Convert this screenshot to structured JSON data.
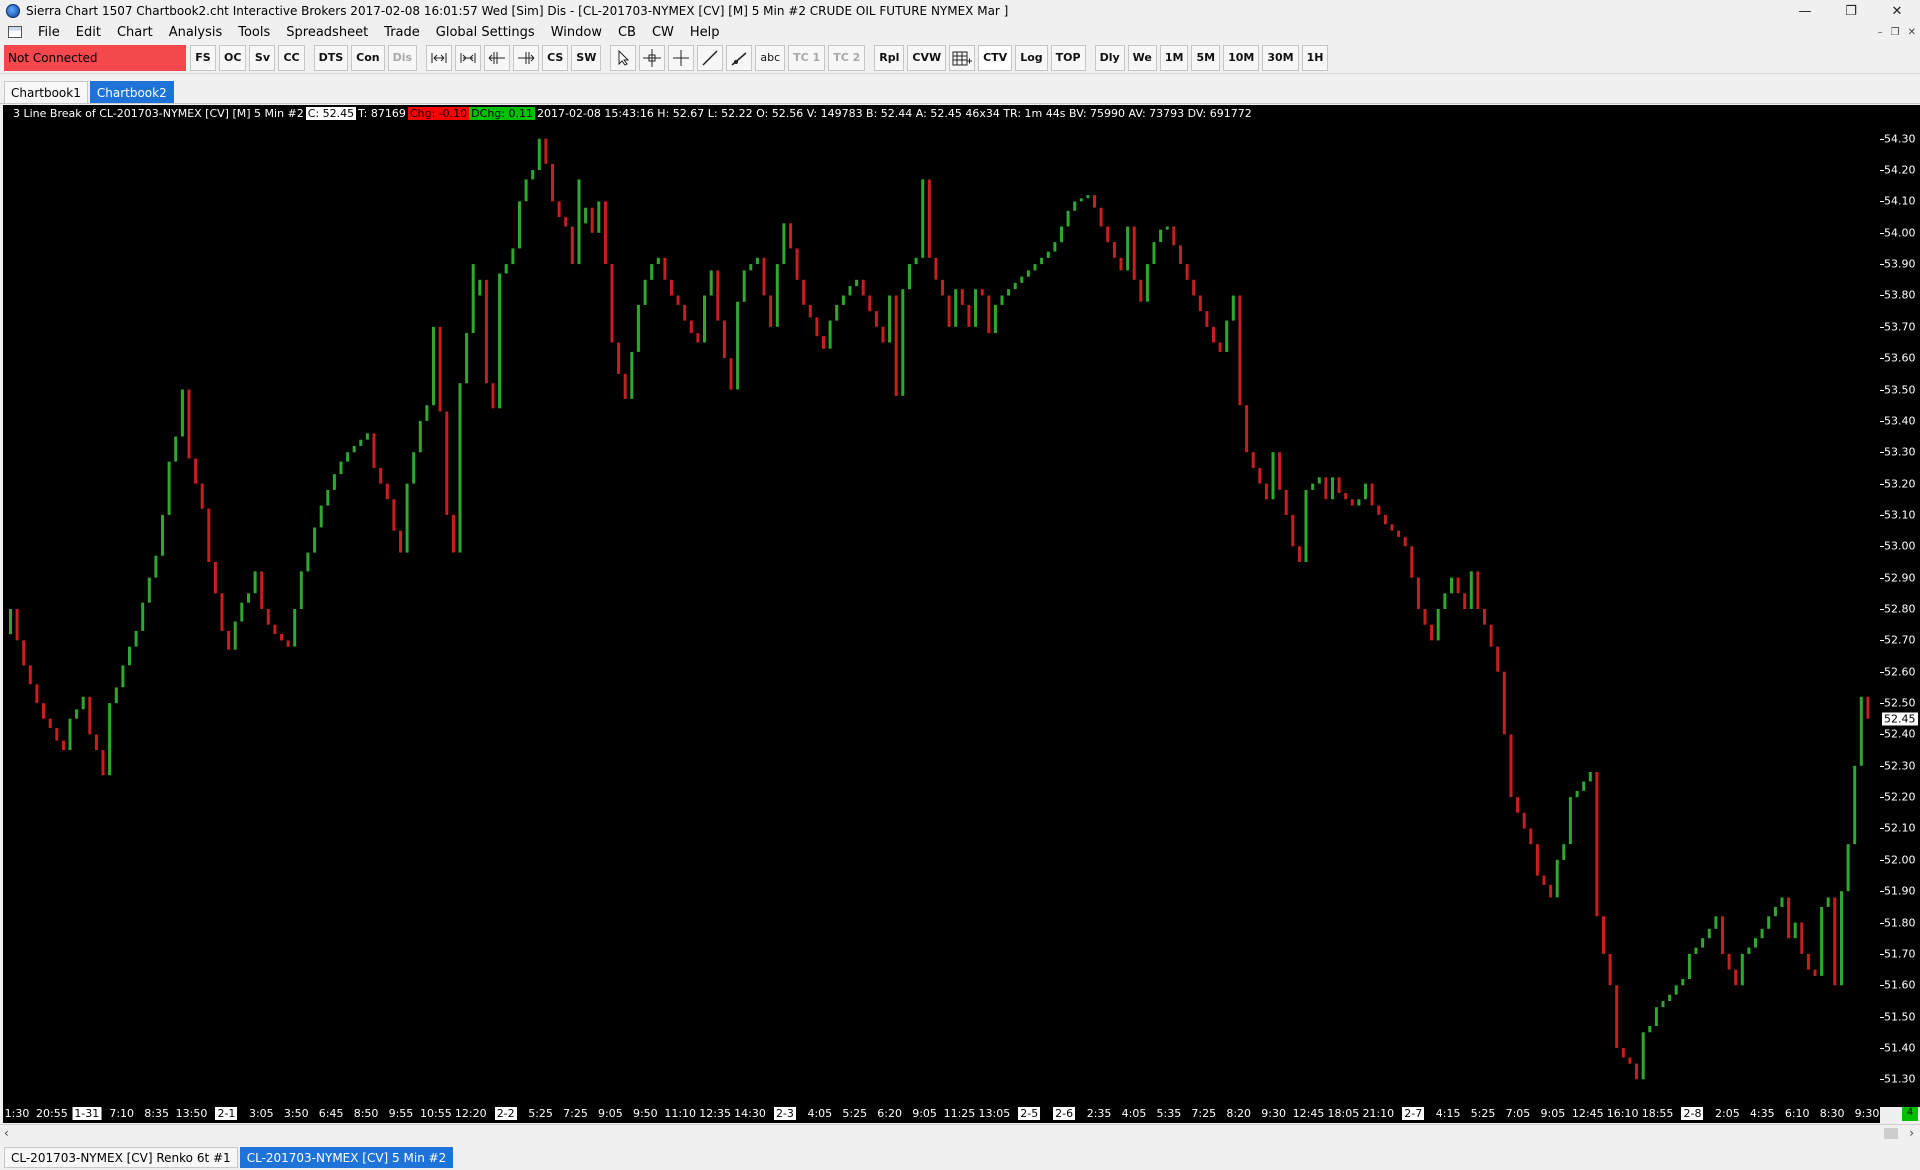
{
  "window": {
    "title": "Sierra Chart 1507 Chartbook2.cht  Interactive Brokers 2017-02-08  16:01:57 Wed [Sim]  Dis - [CL-201703-NYMEX [CV] [M]  5 Min  #2  CRUDE OIL FUTURE NYMEX Mar ]",
    "minimize": "—",
    "restore": "❐",
    "close": "✕"
  },
  "menu": {
    "items": [
      "File",
      "Edit",
      "Chart",
      "Analysis",
      "Tools",
      "Spreadsheet",
      "Trade",
      "Global Settings",
      "Window",
      "CB",
      "CW",
      "Help"
    ],
    "mdi": [
      "–",
      "❐",
      "✕"
    ]
  },
  "toolbar": {
    "status": "Not Connected",
    "group1": [
      "FS",
      "OC",
      "Sv",
      "CC"
    ],
    "group2": [
      "DTS",
      "Con",
      "Dis"
    ],
    "group3_icons": [
      "zoom-out-icon",
      "zoom-in-icon",
      "shift-left-icon",
      "shift-right-icon"
    ],
    "group3_labels": [
      "CS",
      "SW"
    ],
    "group4_icons": [
      "pointer-icon",
      "crosshair-icon",
      "cursor-cross-icon",
      "line-tool-icon",
      "ray-tool-icon"
    ],
    "group4_labels": [
      "abc",
      "TC 1",
      "TC 2"
    ],
    "group5": [
      "Rpl",
      "CVW"
    ],
    "group6": [
      "CTV",
      "Log",
      "TOP"
    ],
    "group7": [
      "Dly",
      "We",
      "1M",
      "5M",
      "10M",
      "30M",
      "1H"
    ]
  },
  "chartbooks": {
    "tabs": [
      "Chartbook1",
      "Chartbook2"
    ],
    "active": 1
  },
  "info_line": {
    "name": "3 Line Break of CL-201703-NYMEX [CV] [M]  5 Min   #2",
    "c": "C: 52.45",
    "t": "T: 87169",
    "chg": "Chg: -0.10",
    "dchg": "DChg: 0.11",
    "rest": "2017-02-08  15:43:16  H: 52.67  L: 52.22  O: 52.56  V: 149783  B: 52.44  A: 52.45  46x34  TR: 1m 44s  BV: 75990  AV: 73793  DV: 691772"
  },
  "price_axis": {
    "labels": [
      "54.30",
      "54.20",
      "54.10",
      "54.00",
      "53.90",
      "53.80",
      "53.70",
      "53.60",
      "53.50",
      "53.40",
      "53.30",
      "53.20",
      "53.10",
      "53.00",
      "52.90",
      "52.80",
      "52.70",
      "52.60",
      "52.50",
      "52.40",
      "52.30",
      "52.20",
      "52.10",
      "52.00",
      "51.90",
      "51.80",
      "51.70",
      "51.60",
      "51.50",
      "51.40",
      "51.30"
    ],
    "last": "52.45"
  },
  "time_axis": {
    "labels": [
      {
        "t": "1:30",
        "d": false
      },
      {
        "t": "20:55",
        "d": false
      },
      {
        "t": "1-31",
        "d": true
      },
      {
        "t": "7:10",
        "d": false
      },
      {
        "t": "8:35",
        "d": false
      },
      {
        "t": "13:50",
        "d": false
      },
      {
        "t": "2-1",
        "d": true
      },
      {
        "t": "3:05",
        "d": false
      },
      {
        "t": "3:50",
        "d": false
      },
      {
        "t": "6:45",
        "d": false
      },
      {
        "t": "8:50",
        "d": false
      },
      {
        "t": "9:55",
        "d": false
      },
      {
        "t": "10:55",
        "d": false
      },
      {
        "t": "12:20",
        "d": false
      },
      {
        "t": "2-2",
        "d": true
      },
      {
        "t": "5:25",
        "d": false
      },
      {
        "t": "7:25",
        "d": false
      },
      {
        "t": "9:05",
        "d": false
      },
      {
        "t": "9:50",
        "d": false
      },
      {
        "t": "11:10",
        "d": false
      },
      {
        "t": "12:35",
        "d": false
      },
      {
        "t": "14:30",
        "d": false
      },
      {
        "t": "2-3",
        "d": true
      },
      {
        "t": "4:05",
        "d": false
      },
      {
        "t": "5:25",
        "d": false
      },
      {
        "t": "6:20",
        "d": false
      },
      {
        "t": "9:05",
        "d": false
      },
      {
        "t": "11:25",
        "d": false
      },
      {
        "t": "13:05",
        "d": false
      },
      {
        "t": "2-5",
        "d": true
      },
      {
        "t": "2-6",
        "d": true
      },
      {
        "t": "2:35",
        "d": false
      },
      {
        "t": "4:05",
        "d": false
      },
      {
        "t": "5:35",
        "d": false
      },
      {
        "t": "7:25",
        "d": false
      },
      {
        "t": "8:20",
        "d": false
      },
      {
        "t": "9:30",
        "d": false
      },
      {
        "t": "12:45",
        "d": false
      },
      {
        "t": "18:05",
        "d": false
      },
      {
        "t": "21:10",
        "d": false
      },
      {
        "t": "2-7",
        "d": true
      },
      {
        "t": "4:15",
        "d": false
      },
      {
        "t": "5:25",
        "d": false
      },
      {
        "t": "7:05",
        "d": false
      },
      {
        "t": "9:05",
        "d": false
      },
      {
        "t": "12:45",
        "d": false
      },
      {
        "t": "16:10",
        "d": false
      },
      {
        "t": "18:55",
        "d": false
      },
      {
        "t": "2-8",
        "d": true
      },
      {
        "t": "2:05",
        "d": false
      },
      {
        "t": "4:35",
        "d": false
      },
      {
        "t": "6:10",
        "d": false
      },
      {
        "t": "8:30",
        "d": false
      },
      {
        "t": "9:30",
        "d": false
      }
    ],
    "badge": "4"
  },
  "chart_tabs": {
    "tabs": [
      "CL-201703-NYMEX [CV]   Renko 6t  #1",
      "CL-201703-NYMEX [CV]   5 Min   #2"
    ],
    "active": 1
  },
  "colors": {
    "up": "#2ea82e",
    "down": "#c81e1e",
    "background": "#000000",
    "status": "#f5484d",
    "accent": "#1e73d8"
  },
  "chart_data": {
    "type": "bar",
    "title": "3 Line Break of CL-201703-NYMEX [CV] [M]  5 Min   #2",
    "ylim": [
      51.25,
      54.35
    ],
    "yticks_step": 0.1,
    "points": [
      [
        52.8,
        "u"
      ],
      [
        52.7,
        "d"
      ],
      [
        52.62,
        "d"
      ],
      [
        52.56,
        "d"
      ],
      [
        52.5,
        "d"
      ],
      [
        52.45,
        "d"
      ],
      [
        52.42,
        "d"
      ],
      [
        52.38,
        "d"
      ],
      [
        52.35,
        "d"
      ],
      [
        52.45,
        "u"
      ],
      [
        52.48,
        "u"
      ],
      [
        52.52,
        "u"
      ],
      [
        52.4,
        "d"
      ],
      [
        52.35,
        "d"
      ],
      [
        52.27,
        "d"
      ],
      [
        52.5,
        "u"
      ],
      [
        52.55,
        "u"
      ],
      [
        52.62,
        "u"
      ],
      [
        52.68,
        "u"
      ],
      [
        52.73,
        "u"
      ],
      [
        52.82,
        "u"
      ],
      [
        52.9,
        "u"
      ],
      [
        52.97,
        "u"
      ],
      [
        53.1,
        "u"
      ],
      [
        53.27,
        "u"
      ],
      [
        53.35,
        "u"
      ],
      [
        53.5,
        "u"
      ],
      [
        53.28,
        "d"
      ],
      [
        53.2,
        "d"
      ],
      [
        53.12,
        "d"
      ],
      [
        52.95,
        "d"
      ],
      [
        52.85,
        "d"
      ],
      [
        52.73,
        "d"
      ],
      [
        52.67,
        "d"
      ],
      [
        52.76,
        "u"
      ],
      [
        52.82,
        "u"
      ],
      [
        52.85,
        "u"
      ],
      [
        52.92,
        "u"
      ],
      [
        52.8,
        "d"
      ],
      [
        52.75,
        "d"
      ],
      [
        52.72,
        "d"
      ],
      [
        52.7,
        "d"
      ],
      [
        52.68,
        "d"
      ],
      [
        52.8,
        "u"
      ],
      [
        52.92,
        "u"
      ],
      [
        52.98,
        "u"
      ],
      [
        53.06,
        "u"
      ],
      [
        53.13,
        "u"
      ],
      [
        53.18,
        "u"
      ],
      [
        53.23,
        "u"
      ],
      [
        53.27,
        "u"
      ],
      [
        53.3,
        "u"
      ],
      [
        53.32,
        "u"
      ],
      [
        53.34,
        "u"
      ],
      [
        53.36,
        "u"
      ],
      [
        53.25,
        "d"
      ],
      [
        53.2,
        "d"
      ],
      [
        53.15,
        "d"
      ],
      [
        53.05,
        "d"
      ],
      [
        52.98,
        "d"
      ],
      [
        53.2,
        "u"
      ],
      [
        53.3,
        "u"
      ],
      [
        53.4,
        "u"
      ],
      [
        53.45,
        "u"
      ],
      [
        53.7,
        "u"
      ],
      [
        53.43,
        "d"
      ],
      [
        53.1,
        "d"
      ],
      [
        52.98,
        "d"
      ],
      [
        53.52,
        "u"
      ],
      [
        53.68,
        "u"
      ],
      [
        53.9,
        "u"
      ],
      [
        53.85,
        "u"
      ],
      [
        53.52,
        "d"
      ],
      [
        53.44,
        "d"
      ],
      [
        53.87,
        "u"
      ],
      [
        53.9,
        "u"
      ],
      [
        53.95,
        "u"
      ],
      [
        54.1,
        "u"
      ],
      [
        54.17,
        "u"
      ],
      [
        54.2,
        "u"
      ],
      [
        54.3,
        "u"
      ],
      [
        54.22,
        "d"
      ],
      [
        54.1,
        "d"
      ],
      [
        54.05,
        "d"
      ],
      [
        54.02,
        "d"
      ],
      [
        53.9,
        "d"
      ],
      [
        54.17,
        "u"
      ],
      [
        54.08,
        "u"
      ],
      [
        54.0,
        "d"
      ],
      [
        54.1,
        "u"
      ],
      [
        53.9,
        "d"
      ],
      [
        53.65,
        "d"
      ],
      [
        53.55,
        "d"
      ],
      [
        53.47,
        "d"
      ],
      [
        53.62,
        "u"
      ],
      [
        53.77,
        "u"
      ],
      [
        53.85,
        "u"
      ],
      [
        53.9,
        "u"
      ],
      [
        53.92,
        "u"
      ],
      [
        53.85,
        "d"
      ],
      [
        53.8,
        "d"
      ],
      [
        53.77,
        "d"
      ],
      [
        53.72,
        "d"
      ],
      [
        53.68,
        "d"
      ],
      [
        53.65,
        "d"
      ],
      [
        53.8,
        "u"
      ],
      [
        53.88,
        "u"
      ],
      [
        53.72,
        "d"
      ],
      [
        53.6,
        "d"
      ],
      [
        53.5,
        "d"
      ],
      [
        53.78,
        "u"
      ],
      [
        53.88,
        "u"
      ],
      [
        53.9,
        "u"
      ],
      [
        53.92,
        "u"
      ],
      [
        53.8,
        "d"
      ],
      [
        53.7,
        "d"
      ],
      [
        53.9,
        "u"
      ],
      [
        54.03,
        "u"
      ],
      [
        53.95,
        "d"
      ],
      [
        53.85,
        "d"
      ],
      [
        53.77,
        "d"
      ],
      [
        53.73,
        "d"
      ],
      [
        53.67,
        "d"
      ],
      [
        53.63,
        "d"
      ],
      [
        53.72,
        "u"
      ],
      [
        53.77,
        "u"
      ],
      [
        53.8,
        "u"
      ],
      [
        53.83,
        "u"
      ],
      [
        53.85,
        "u"
      ],
      [
        53.8,
        "d"
      ],
      [
        53.75,
        "d"
      ],
      [
        53.7,
        "d"
      ],
      [
        53.65,
        "d"
      ],
      [
        53.8,
        "u"
      ],
      [
        53.48,
        "d"
      ],
      [
        53.82,
        "u"
      ],
      [
        53.9,
        "u"
      ],
      [
        53.92,
        "u"
      ],
      [
        54.17,
        "u"
      ],
      [
        53.92,
        "d"
      ],
      [
        53.85,
        "d"
      ],
      [
        53.8,
        "d"
      ],
      [
        53.7,
        "d"
      ],
      [
        53.82,
        "u"
      ],
      [
        53.77,
        "d"
      ],
      [
        53.7,
        "d"
      ],
      [
        53.82,
        "u"
      ],
      [
        53.8,
        "d"
      ],
      [
        53.68,
        "d"
      ],
      [
        53.77,
        "u"
      ],
      [
        53.8,
        "u"
      ],
      [
        53.82,
        "u"
      ],
      [
        53.84,
        "u"
      ],
      [
        53.86,
        "u"
      ],
      [
        53.88,
        "u"
      ],
      [
        53.9,
        "u"
      ],
      [
        53.92,
        "u"
      ],
      [
        53.94,
        "u"
      ],
      [
        53.97,
        "u"
      ],
      [
        54.02,
        "u"
      ],
      [
        54.07,
        "u"
      ],
      [
        54.1,
        "u"
      ],
      [
        54.11,
        "u"
      ],
      [
        54.12,
        "u"
      ],
      [
        54.08,
        "d"
      ],
      [
        54.02,
        "d"
      ],
      [
        53.97,
        "d"
      ],
      [
        53.92,
        "d"
      ],
      [
        53.88,
        "d"
      ],
      [
        54.02,
        "u"
      ],
      [
        53.85,
        "d"
      ],
      [
        53.78,
        "d"
      ],
      [
        53.9,
        "u"
      ],
      [
        53.97,
        "u"
      ],
      [
        54.01,
        "u"
      ],
      [
        54.02,
        "u"
      ],
      [
        53.96,
        "d"
      ],
      [
        53.9,
        "d"
      ],
      [
        53.85,
        "d"
      ],
      [
        53.8,
        "d"
      ],
      [
        53.75,
        "d"
      ],
      [
        53.7,
        "d"
      ],
      [
        53.65,
        "d"
      ],
      [
        53.62,
        "d"
      ],
      [
        53.72,
        "u"
      ],
      [
        53.8,
        "u"
      ],
      [
        53.45,
        "d"
      ],
      [
        53.3,
        "d"
      ],
      [
        53.25,
        "d"
      ],
      [
        53.2,
        "d"
      ],
      [
        53.15,
        "d"
      ],
      [
        53.3,
        "u"
      ],
      [
        53.18,
        "d"
      ],
      [
        53.1,
        "d"
      ],
      [
        53.0,
        "d"
      ],
      [
        52.95,
        "d"
      ],
      [
        53.18,
        "u"
      ],
      [
        53.2,
        "u"
      ],
      [
        53.22,
        "u"
      ],
      [
        53.15,
        "d"
      ],
      [
        53.22,
        "u"
      ],
      [
        53.17,
        "d"
      ],
      [
        53.15,
        "d"
      ],
      [
        53.13,
        "d"
      ],
      [
        53.15,
        "u"
      ],
      [
        53.2,
        "u"
      ],
      [
        53.13,
        "d"
      ],
      [
        53.1,
        "d"
      ],
      [
        53.07,
        "d"
      ],
      [
        53.05,
        "d"
      ],
      [
        53.03,
        "d"
      ],
      [
        53.0,
        "d"
      ],
      [
        52.9,
        "d"
      ],
      [
        52.8,
        "d"
      ],
      [
        52.75,
        "d"
      ],
      [
        52.7,
        "d"
      ],
      [
        52.8,
        "u"
      ],
      [
        52.85,
        "u"
      ],
      [
        52.9,
        "u"
      ],
      [
        52.85,
        "d"
      ],
      [
        52.8,
        "d"
      ],
      [
        52.92,
        "u"
      ],
      [
        52.8,
        "d"
      ],
      [
        52.75,
        "d"
      ],
      [
        52.68,
        "d"
      ],
      [
        52.6,
        "d"
      ],
      [
        52.4,
        "d"
      ],
      [
        52.2,
        "d"
      ],
      [
        52.15,
        "d"
      ],
      [
        52.1,
        "d"
      ],
      [
        52.05,
        "d"
      ],
      [
        51.95,
        "d"
      ],
      [
        51.92,
        "d"
      ],
      [
        51.88,
        "d"
      ],
      [
        52.0,
        "u"
      ],
      [
        52.05,
        "u"
      ],
      [
        52.2,
        "u"
      ],
      [
        52.22,
        "u"
      ],
      [
        52.25,
        "u"
      ],
      [
        52.28,
        "u"
      ],
      [
        51.82,
        "d"
      ],
      [
        51.7,
        "d"
      ],
      [
        51.6,
        "d"
      ],
      [
        51.4,
        "d"
      ],
      [
        51.37,
        "d"
      ],
      [
        51.35,
        "d"
      ],
      [
        51.3,
        "d"
      ],
      [
        51.45,
        "u"
      ],
      [
        51.47,
        "u"
      ],
      [
        51.53,
        "u"
      ],
      [
        51.55,
        "u"
      ],
      [
        51.57,
        "u"
      ],
      [
        51.6,
        "u"
      ],
      [
        51.62,
        "u"
      ],
      [
        51.7,
        "u"
      ],
      [
        51.72,
        "u"
      ],
      [
        51.75,
        "u"
      ],
      [
        51.78,
        "u"
      ],
      [
        51.82,
        "u"
      ],
      [
        51.7,
        "d"
      ],
      [
        51.65,
        "d"
      ],
      [
        51.6,
        "d"
      ],
      [
        51.7,
        "u"
      ],
      [
        51.72,
        "u"
      ],
      [
        51.75,
        "u"
      ],
      [
        51.78,
        "u"
      ],
      [
        51.82,
        "u"
      ],
      [
        51.85,
        "u"
      ],
      [
        51.88,
        "u"
      ],
      [
        51.75,
        "d"
      ],
      [
        51.8,
        "u"
      ],
      [
        51.7,
        "d"
      ],
      [
        51.65,
        "d"
      ],
      [
        51.63,
        "d"
      ],
      [
        51.85,
        "u"
      ],
      [
        51.88,
        "u"
      ],
      [
        51.6,
        "d"
      ],
      [
        51.9,
        "u"
      ],
      [
        52.05,
        "u"
      ],
      [
        52.3,
        "u"
      ],
      [
        52.52,
        "u"
      ],
      [
        52.45,
        "d"
      ]
    ]
  }
}
